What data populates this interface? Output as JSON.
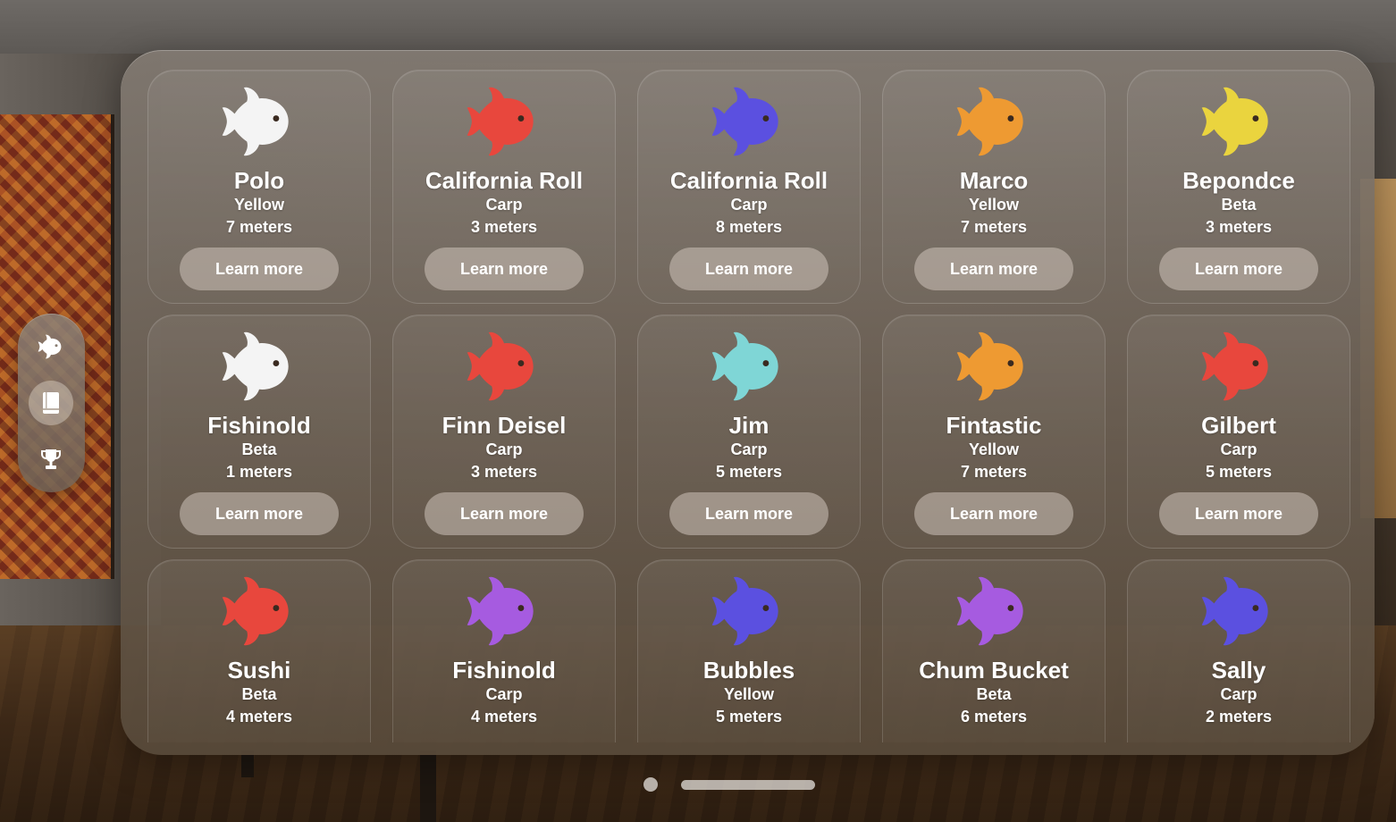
{
  "sidebar": {
    "items": [
      {
        "icon": "fish-icon"
      },
      {
        "icon": "book-icon",
        "selected": true
      },
      {
        "icon": "trophy-icon"
      }
    ]
  },
  "colors": {
    "white": "#f4f4f4",
    "red": "#e8473d",
    "blue": "#5b50e0",
    "orange": "#ee9a32",
    "yellow": "#ead43e",
    "teal": "#7fd6d6",
    "purple": "#a65be0"
  },
  "fish": [
    {
      "name": "Polo",
      "species": "Yellow",
      "size": "7 meters",
      "color": "white",
      "button": "Learn more"
    },
    {
      "name": "California Roll",
      "species": "Carp",
      "size": "3 meters",
      "color": "red",
      "button": "Learn more"
    },
    {
      "name": "California Roll",
      "species": "Carp",
      "size": "8 meters",
      "color": "blue",
      "button": "Learn more"
    },
    {
      "name": "Marco",
      "species": "Yellow",
      "size": "7 meters",
      "color": "orange",
      "button": "Learn more"
    },
    {
      "name": "Bepondce",
      "species": "Beta",
      "size": "3 meters",
      "color": "yellow",
      "button": "Learn more"
    },
    {
      "name": "Fishinold",
      "species": "Beta",
      "size": "1 meters",
      "color": "white",
      "button": "Learn more"
    },
    {
      "name": "Finn Deisel",
      "species": "Carp",
      "size": "3 meters",
      "color": "red",
      "button": "Learn more"
    },
    {
      "name": "Jim",
      "species": "Carp",
      "size": "5 meters",
      "color": "teal",
      "button": "Learn more"
    },
    {
      "name": "Fintastic",
      "species": "Yellow",
      "size": "7 meters",
      "color": "orange",
      "button": "Learn more"
    },
    {
      "name": "Gilbert",
      "species": "Carp",
      "size": "5 meters",
      "color": "red",
      "button": "Learn more"
    },
    {
      "name": "Sushi",
      "species": "Beta",
      "size": "4 meters",
      "color": "red"
    },
    {
      "name": "Fishinold",
      "species": "Carp",
      "size": "4 meters",
      "color": "purple"
    },
    {
      "name": "Bubbles",
      "species": "Yellow",
      "size": "5 meters",
      "color": "blue"
    },
    {
      "name": "Chum Bucket",
      "species": "Beta",
      "size": "6 meters",
      "color": "purple"
    },
    {
      "name": "Sally",
      "species": "Carp",
      "size": "2 meters",
      "color": "blue"
    }
  ],
  "pager": {
    "current_page": 1
  }
}
